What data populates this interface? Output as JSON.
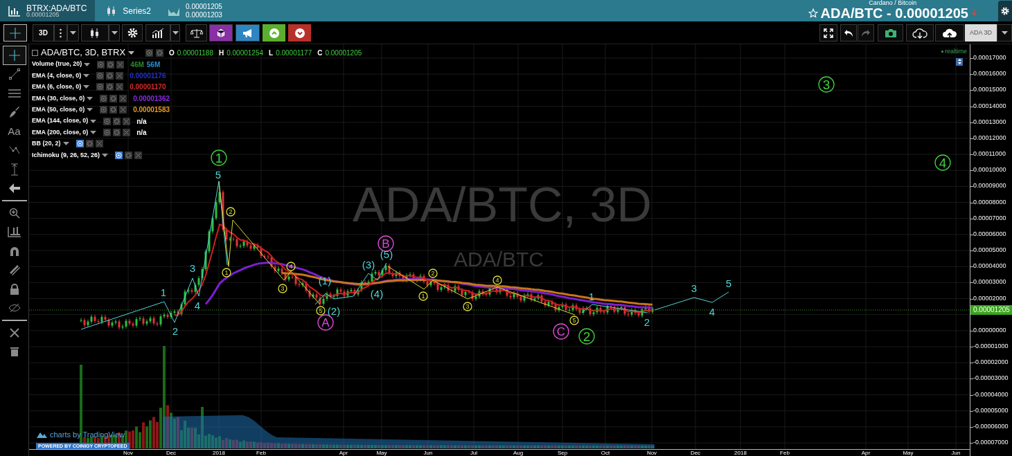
{
  "tabs": [
    {
      "kind": "bars",
      "label": "BTRX:ADA/BTC",
      "sub": "0.00001205",
      "selected": true
    },
    {
      "kind": "candles",
      "label": "Series2",
      "selected": false
    },
    {
      "kind": "area",
      "label": "0.00001205",
      "sub": "0.00001203",
      "selected": false
    }
  ],
  "header": {
    "subtitle": "Cardano / Bitcoin",
    "title": "ADA/BTC - 0.00001205"
  },
  "toolbar": {
    "interval": "3D",
    "layout": "ADA 3D"
  },
  "drawing_tools": {
    "text_tool": "Aa"
  },
  "legend": {
    "symbol": "ADA/BTC, 3D, BTRX",
    "ohlc": [
      {
        "key": "O",
        "value": "0.00001188"
      },
      {
        "key": "H",
        "value": "0.00001254"
      },
      {
        "key": "L",
        "value": "0.00001177"
      },
      {
        "key": "C",
        "value": "0.00001205"
      }
    ]
  },
  "indicators": [
    {
      "name": "Volume (true, 20)",
      "hidden": false,
      "values": [
        {
          "text": "46M",
          "color": "#2e8b2e"
        },
        {
          "text": "56M",
          "color": "#2b8fd6"
        }
      ]
    },
    {
      "name": "EMA (4, close, 0)",
      "hidden": false,
      "values": [
        {
          "text": "0.00001176",
          "color": "#1f2fc8"
        }
      ]
    },
    {
      "name": "EMA (6, close, 0)",
      "hidden": false,
      "values": [
        {
          "text": "0.00001170",
          "color": "#d42a2a"
        }
      ]
    },
    {
      "name": "EMA (30, close, 0)",
      "hidden": false,
      "values": [
        {
          "text": "0.00001362",
          "color": "#8a2be2"
        }
      ]
    },
    {
      "name": "EMA (50, close, 0)",
      "hidden": false,
      "values": [
        {
          "text": "0.00001583",
          "color": "#f09a1a"
        }
      ]
    },
    {
      "name": "EMA (144, close, 0)",
      "hidden": false,
      "values": [
        {
          "text": "n/a",
          "color": "#ffffff"
        }
      ]
    },
    {
      "name": "EMA (200, close, 0)",
      "hidden": false,
      "values": [
        {
          "text": "n/a",
          "color": "#ffffff"
        }
      ]
    },
    {
      "name": "BB (20, 2)",
      "hidden": true
    },
    {
      "name": "Ichimoku (9, 26, 52, 26)",
      "hidden": true
    }
  ],
  "watermark": {
    "title": "ADA/BTC, 3D",
    "subtitle": "ADA/BTC"
  },
  "realtime": "realtime",
  "price_axis": [
    "0.00017000",
    "0.00016000",
    "0.00015000",
    "0.00014000",
    "0.00013000",
    "0.00012000",
    "0.00011000",
    "0.00010000",
    "0.00009000",
    "0.00008000",
    "0.00007000",
    "0.00006000",
    "0.00005000",
    "0.00004000",
    "0.00003000",
    "0.00002000",
    "0.00000000",
    "-0.00001000",
    "-0.00002000",
    "-0.00003000",
    "-0.00004000",
    "-0.00005000",
    "-0.00006000",
    "-0.00007000"
  ],
  "last_price": "0.00001205",
  "time_axis": [
    "Nov",
    "Dec",
    "2018",
    "Feb",
    "Apr",
    "May",
    "Jun",
    "Jul",
    "Aug",
    "Sep",
    "Oct",
    "Nov",
    "Dec",
    "2018",
    "Feb",
    "Apr",
    "May",
    "Jun"
  ],
  "annotations": [
    {
      "kind": "circle",
      "label": "3"
    },
    {
      "kind": "circle",
      "label": "1"
    },
    {
      "kind": "circle",
      "label": "4"
    },
    {
      "kind": "plain",
      "label": "5"
    },
    {
      "kind": "small",
      "label": "2"
    },
    {
      "kind": "letter",
      "label": "B"
    },
    {
      "kind": "plain",
      "label": "(5)"
    },
    {
      "kind": "plain",
      "label": "3"
    },
    {
      "kind": "small",
      "label": "1"
    },
    {
      "kind": "small",
      "label": "4"
    },
    {
      "kind": "plain",
      "label": "(3)"
    },
    {
      "kind": "small",
      "label": "2"
    },
    {
      "kind": "plain",
      "label": "(1)"
    },
    {
      "kind": "small",
      "label": "4"
    },
    {
      "kind": "plain",
      "label": "5"
    },
    {
      "kind": "plain",
      "label": "1"
    },
    {
      "kind": "small",
      "label": "3"
    },
    {
      "kind": "plain",
      "label": "(4)"
    },
    {
      "kind": "small",
      "label": "1"
    },
    {
      "kind": "plain",
      "label": "1"
    },
    {
      "kind": "plain",
      "label": "3"
    },
    {
      "kind": "plain",
      "label": "4"
    },
    {
      "kind": "small",
      "label": "5"
    },
    {
      "kind": "plain",
      "label": "(2)"
    },
    {
      "kind": "small",
      "label": "3"
    },
    {
      "kind": "plain",
      "label": "4"
    },
    {
      "kind": "letter",
      "label": "A"
    },
    {
      "kind": "small",
      "label": "5"
    },
    {
      "kind": "plain",
      "label": "2"
    },
    {
      "kind": "plain",
      "label": "2"
    },
    {
      "kind": "letter",
      "label": "C"
    },
    {
      "kind": "circle",
      "label": "2"
    }
  ],
  "branding": {
    "logo": "charts by TradingView",
    "badge": "POWERED BY COINIGY CRYPTOFEED"
  }
}
